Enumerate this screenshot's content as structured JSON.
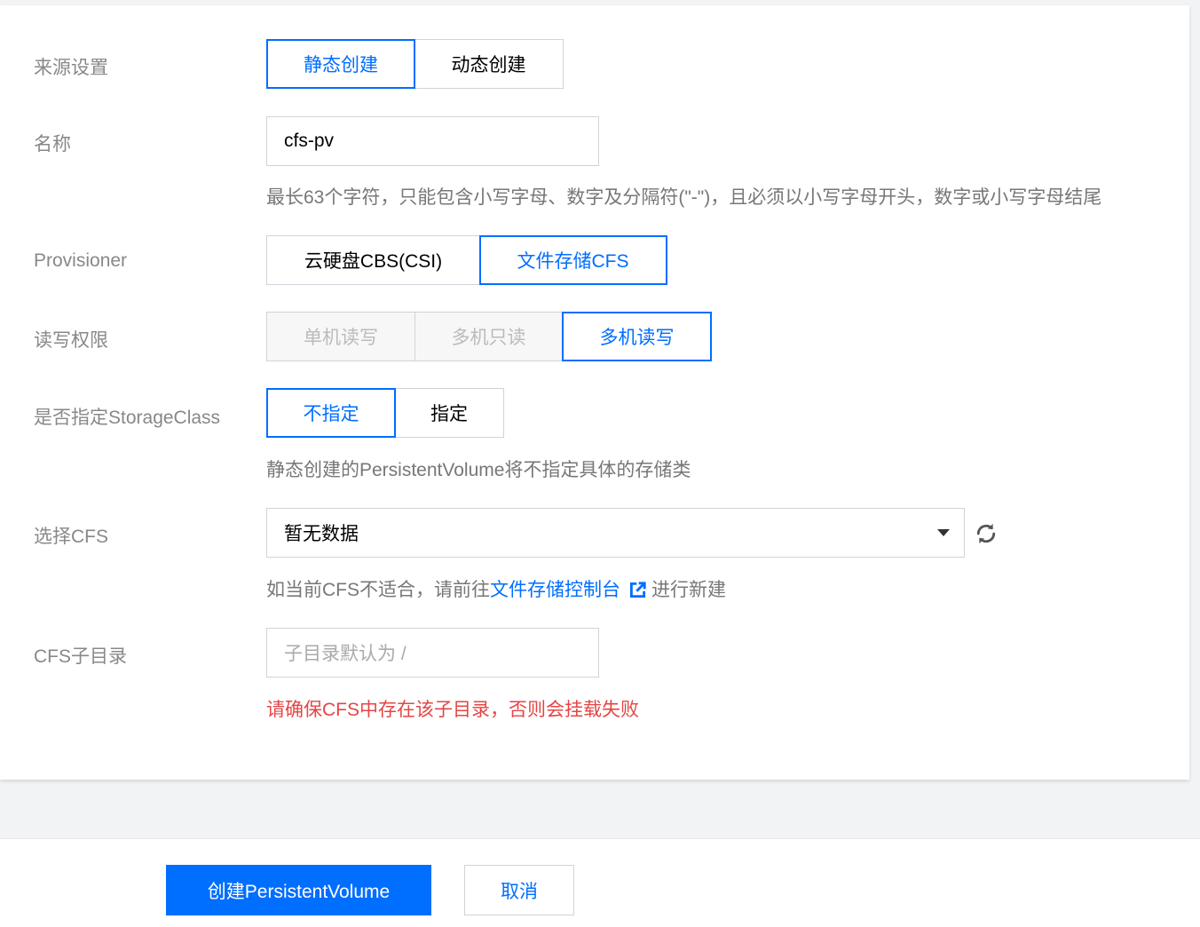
{
  "form": {
    "source": {
      "label": "来源设置",
      "options": [
        "静态创建",
        "动态创建"
      ],
      "selected": "静态创建"
    },
    "name": {
      "label": "名称",
      "value": "cfs-pv",
      "help": "最长63个字符，只能包含小写字母、数字及分隔符(\"-\")，且必须以小写字母开头，数字或小写字母结尾"
    },
    "provisioner": {
      "label": "Provisioner",
      "options": [
        "云硬盘CBS(CSI)",
        "文件存储CFS"
      ],
      "selected": "文件存储CFS"
    },
    "access": {
      "label": "读写权限",
      "options": [
        "单机读写",
        "多机只读",
        "多机读写"
      ],
      "selected": "多机读写",
      "disabled": [
        "单机读写",
        "多机只读"
      ]
    },
    "storage_class": {
      "label": "是否指定StorageClass",
      "options": [
        "不指定",
        "指定"
      ],
      "selected": "不指定",
      "help": "静态创建的PersistentVolume将不指定具体的存储类"
    },
    "cfs": {
      "label": "选择CFS",
      "value": "暂无数据",
      "help_prefix": "如当前CFS不适合，请前往",
      "help_link": "文件存储控制台",
      "help_suffix": "进行新建"
    },
    "subdir": {
      "label": "CFS子目录",
      "placeholder": "子目录默认为 /",
      "error": "请确保CFS中存在该子目录，否则会挂载失败"
    }
  },
  "footer": {
    "create_label": "创建PersistentVolume",
    "cancel_label": "取消"
  },
  "colors": {
    "accent": "#006eff",
    "error": "#e54545",
    "label": "#888888",
    "border": "#cfd3d9"
  }
}
